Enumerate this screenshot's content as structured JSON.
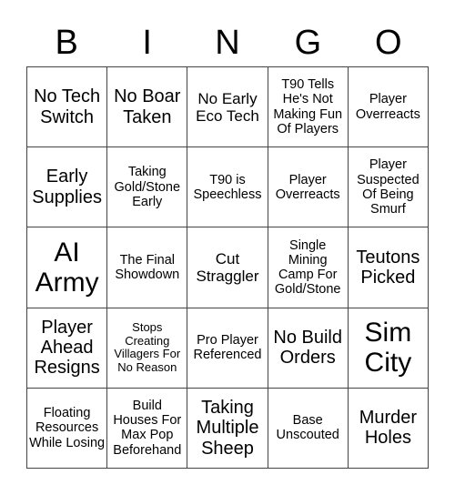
{
  "header": [
    "B",
    "I",
    "N",
    "G",
    "O"
  ],
  "cells": [
    [
      "No Tech Switch",
      "No Boar Taken",
      "No Early Eco Tech",
      "T90 Tells He's Not Making Fun Of Players",
      "Player Overreacts"
    ],
    [
      "Early Supplies",
      "Taking Gold/Stone Early",
      "T90 is Speechless",
      "Player Overreacts",
      "Player Suspected Of Being Smurf"
    ],
    [
      "AI Army",
      "The Final Showdown",
      "Cut Straggler",
      "Single Mining Camp For Gold/Stone",
      "Teutons Picked"
    ],
    [
      "Player Ahead Resigns",
      "Stops Creating Villagers For No Reason",
      "Pro Player Referenced",
      "No Build Orders",
      "Sim City"
    ],
    [
      "Floating Resources While Losing",
      "Build Houses For Max Pop Beforehand",
      "Taking Multiple Sheep",
      "Base Unscouted",
      "Murder Holes"
    ]
  ]
}
